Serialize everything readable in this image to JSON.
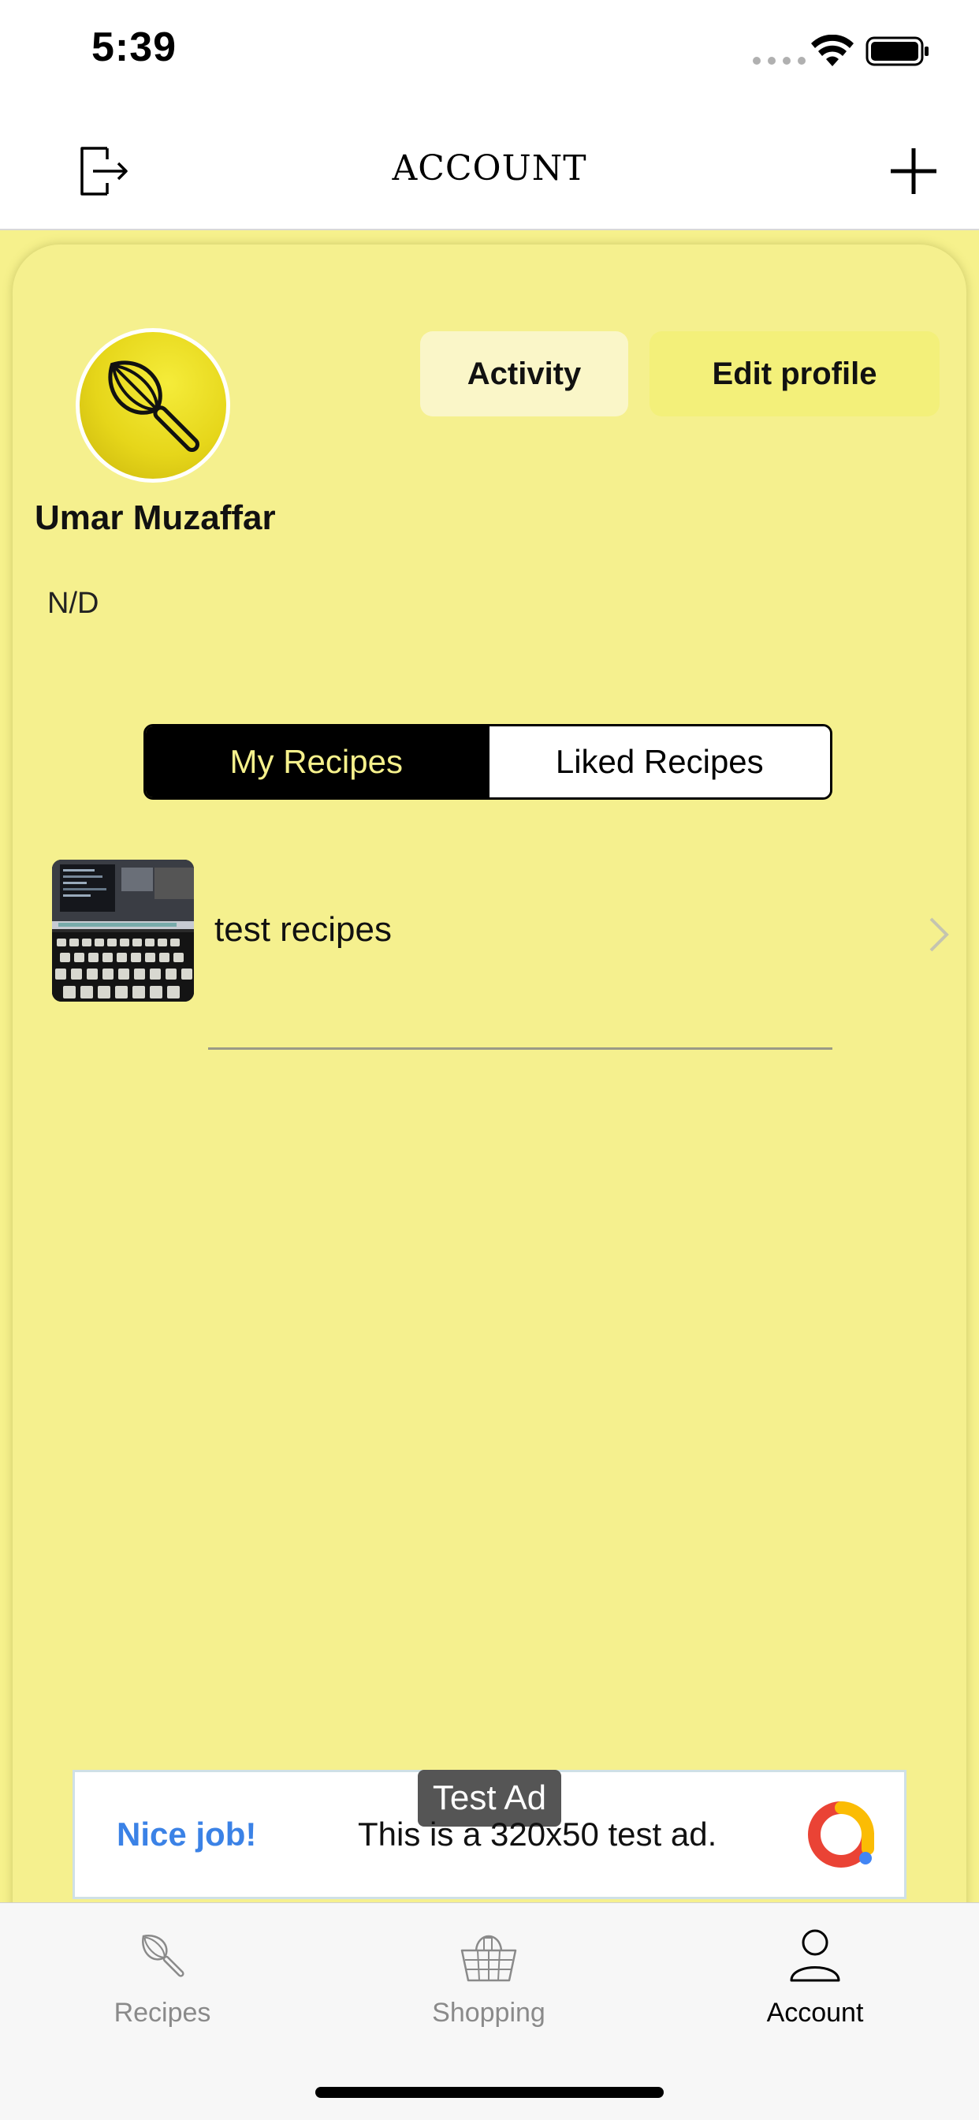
{
  "status_bar": {
    "time": "5:39"
  },
  "nav": {
    "title": "ACCOUNT",
    "left_icon": "logout-icon",
    "right_icon": "plus-icon"
  },
  "profile": {
    "name": "Umar Muzaffar",
    "bio": "N/D",
    "avatar_icon": "whisk-icon",
    "activity_label": "Activity",
    "edit_label": "Edit profile"
  },
  "segments": {
    "active": "My Recipes",
    "inactive": "Liked Recipes"
  },
  "recipes": [
    {
      "title": "test recipes"
    }
  ],
  "ad": {
    "badge": "Test Ad",
    "headline": "Nice job!",
    "body": "This is a 320x50 test ad."
  },
  "tabs": [
    {
      "label": "Recipes",
      "icon": "whisk-icon",
      "active": false
    },
    {
      "label": "Shopping",
      "icon": "basket-icon",
      "active": false
    },
    {
      "label": "Account",
      "icon": "person-icon",
      "active": true
    }
  ],
  "colors": {
    "background_yellow": "#f6f18c",
    "accent_black": "#000000",
    "ad_blue": "#3b82e6"
  }
}
